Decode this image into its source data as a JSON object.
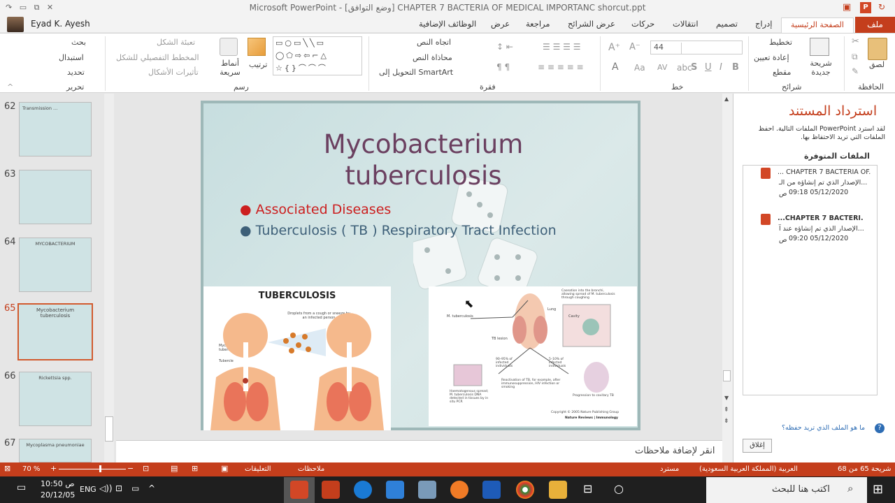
{
  "titlebar": {
    "title": "Microsoft PowerPoint - [وضع التوافق] CHAPTER 7  BACTERIA OF MEDICAL IMPORTANC shorcut.ppt"
  },
  "user": {
    "name": "Eyad K. Ayesh"
  },
  "tabs": {
    "file": "ملف",
    "home": "الصفحة الرئيسية",
    "insert": "إدراج",
    "design": "تصميم",
    "transitions": "انتقالات",
    "animations": "حركات",
    "slideshow": "عرض الشرائح",
    "review": "مراجعة",
    "view": "عرض",
    "addins": "الوظائف الإضافية"
  },
  "ribbon": {
    "paste": "لصق",
    "clipboard": "الحافظة",
    "new_slide": "شريحة جديدة",
    "layout": "تخطيط",
    "reset": "إعادة تعيين",
    "section": "مقطع",
    "slides_group": "شرائح",
    "font_size": "44",
    "font_group": "خط",
    "text_direction": "اتجاه النص",
    "align_text": "محاذاة النص",
    "smartart": "التحويل إلى SmartArt",
    "paragraph_group": "فقرة",
    "arrange": "ترتيب",
    "quick_styles": "أنماط سريعة",
    "shape_fill": "تعبئة الشكل",
    "shape_outline": "المخطط التفصيلي للشكل",
    "shape_effects": "تأثيرات الأشكال",
    "drawing_group": "رسم",
    "find": "بحث",
    "replace": "استبدال",
    "select": "تحديد",
    "editing_group": "تحرير"
  },
  "thumbnails": [
    {
      "num": "62",
      "text": "Transmission ..."
    },
    {
      "num": "63",
      "text": ""
    },
    {
      "num": "64",
      "text": "MYCOBACTERIUM"
    },
    {
      "num": "65",
      "text": "Mycobacterium tuberculosis"
    },
    {
      "num": "66",
      "text": "Rickettsia spp."
    },
    {
      "num": "67",
      "text": "Mycoplasma pneumoniae"
    }
  ],
  "slide": {
    "title_line1": "Mycobacterium",
    "title_line2": "tuberculosis",
    "bullet1": "Associated Diseases",
    "bullet2": "Tuberculosis ( TB ) Respiratory Tract Infection",
    "bullet1_color": "#cc1f1f",
    "bullet2_color": "#3d5f78",
    "img1_title": "TUBERCULOSIS",
    "img1_caption": "Droplets from a cough or sneeze by an infected person",
    "img1_label1": "Mycobacterium tuberculosis",
    "img1_label2": "Tubercle",
    "img2_labels": {
      "mtb": "M. tuberculosis",
      "lung": "Lung",
      "tb_lesion": "TB lesion",
      "cavity": "Cavity",
      "caseation": "Caseation into the bronchi, allowing spread of M. tuberculosis through coughing",
      "pct1": "90–95% of infected individuals",
      "pct2": "5–10% of infected individuals",
      "reactivation": "Reactivation of TB, for example, after immunosuppression, HIV infection or smoking",
      "haemato": "Haematogenous spread; M. tuberculosis DNA detected in tissues by in situ PCR",
      "progression": "Progression to cavitary TB",
      "copyright": "Copyright © 2005 Nature Publishing Group",
      "journal": "Nature Reviews | Immunology"
    }
  },
  "notes": {
    "placeholder": "انقر لإضافة ملاحظات"
  },
  "recovery": {
    "title": "استرداد المستند",
    "desc": "لقد استرد PowerPoint الملفات التالية. احفظ الملفات التي تريد الاحتفاظ بها.",
    "available": "الملفات المتوفرة",
    "files": [
      {
        "name": "... CHAPTER 7  BACTERIA OF.",
        "version": "الإصدار الذي تم إنشاؤه من الـ...",
        "time": "09:18 05/12/2020",
        "ampm": "ص"
      },
      {
        "name": "...CHAPTER 7  BACTERI.",
        "version": "الإصدار الذي تم إنشاؤه عند آ...",
        "time": "09:20 05/12/2020",
        "ampm": "ص"
      }
    ],
    "which_file": "ما هو الملف الذي تريد حفظه؟",
    "close": "إغلاق"
  },
  "status": {
    "slide_of": "شريحة 65 من 68",
    "language": "العربية (المملكة العربية السعودية)",
    "recovered": "مسترد",
    "notes": "ملاحظات",
    "comments": "التعليقات",
    "zoom": "70 %"
  },
  "taskbar": {
    "search": "اكتب هنا للبحث",
    "time": "10:50 ص",
    "date": "20/12/05",
    "lang": "ENG"
  }
}
